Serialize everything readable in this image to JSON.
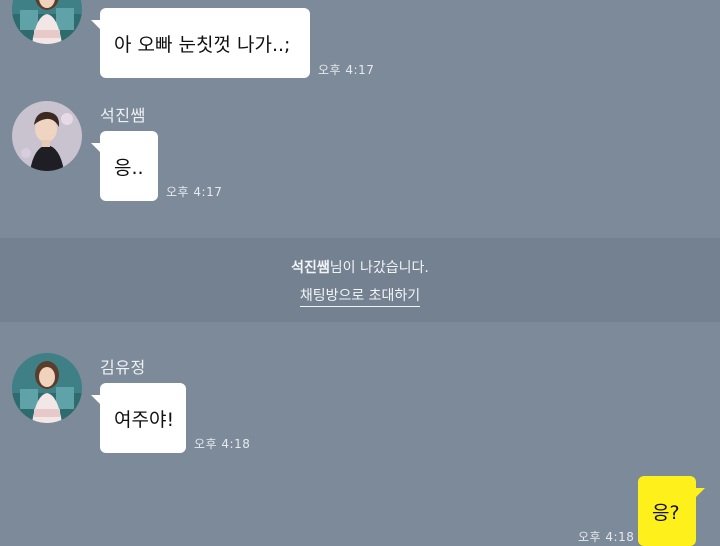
{
  "chat": {
    "messages": [
      {
        "text": "아 오빠 눈칫껏 나가..;",
        "time": "오후 4:17"
      },
      {
        "sender": "석진쌤",
        "text": "응..",
        "time": "오후 4:17"
      },
      {
        "sender": "김유정",
        "text": "여주야!",
        "time": "오후 4:18"
      },
      {
        "text": "응?",
        "time": "오후 4:18"
      }
    ],
    "system": {
      "name": "석진쌤",
      "suffix": "님이 나갔습니다.",
      "invite_link": "채팅방으로 초대하기"
    }
  },
  "colors": {
    "background": "#7d8a99",
    "system_band": "#748190",
    "bubble_other": "#ffffff",
    "bubble_mine": "#fef01b"
  },
  "icons": {
    "avatar_kim": "woman-portrait-avatar",
    "avatar_seokjin": "man-portrait-avatar"
  }
}
